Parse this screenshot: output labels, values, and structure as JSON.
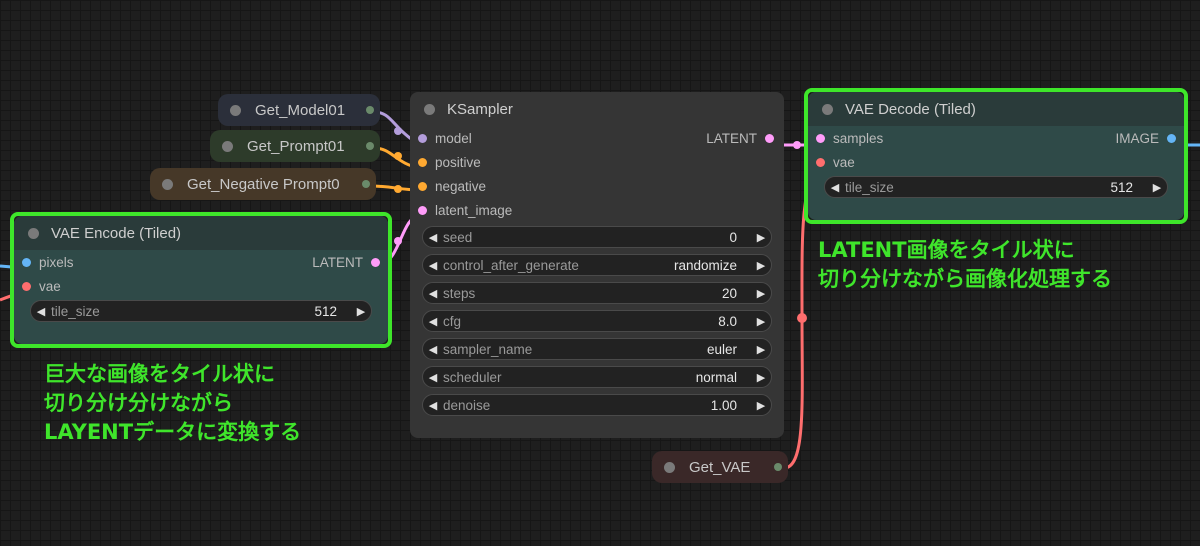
{
  "colors": {
    "node_bg": "#353535",
    "vae_node_bg": "#2f4a48",
    "highlight": "#3ee62a",
    "latent_wire": "#ff9cf9",
    "vae_wire": "#ff6e6e",
    "model_wire": "#b39ddb",
    "conditioning_wire": "#ffa931",
    "image_wire": "#64b5f6"
  },
  "getters": {
    "model": "Get_Model01",
    "prompt": "Get_Prompt01",
    "negative": "Get_Negative Prompt0",
    "vae": "Get_VAE"
  },
  "ksampler": {
    "title": "KSampler",
    "inputs": [
      "model",
      "positive",
      "negative",
      "latent_image"
    ],
    "output": "LATENT",
    "widgets": [
      {
        "label": "seed",
        "value": "0"
      },
      {
        "label": "control_after_generate",
        "value": "randomize"
      },
      {
        "label": "steps",
        "value": "20"
      },
      {
        "label": "cfg",
        "value": "8.0"
      },
      {
        "label": "sampler_name",
        "value": "euler"
      },
      {
        "label": "scheduler",
        "value": "normal"
      },
      {
        "label": "denoise",
        "value": "1.00"
      }
    ]
  },
  "vae_encode": {
    "title": "VAE Encode (Tiled)",
    "inputs": [
      "pixels",
      "vae"
    ],
    "output": "LATENT",
    "widget": {
      "label": "tile_size",
      "value": "512"
    }
  },
  "vae_decode": {
    "title": "VAE Decode (Tiled)",
    "inputs": [
      "samples",
      "vae"
    ],
    "output": "IMAGE",
    "widget": {
      "label": "tile_size",
      "value": "512"
    }
  },
  "annotations": {
    "encode": [
      "巨大な画像をタイル状に",
      "切り分け分けながら",
      "LAYENTデータに変換する"
    ],
    "decode": [
      "LATENT画像をタイル状に",
      "切り分けながら画像化処理する"
    ]
  }
}
